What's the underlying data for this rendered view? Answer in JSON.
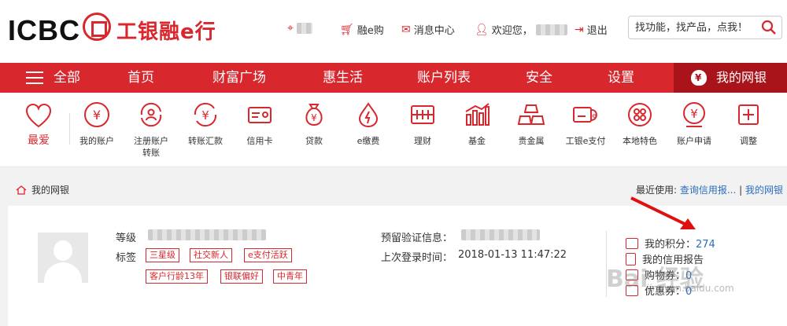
{
  "header": {
    "logo_text": "ICBC",
    "logo_cn": "工银融e行",
    "links": {
      "location": "",
      "rong_e_gou": "融e购",
      "messages": "消息中心",
      "welcome": "欢迎您，",
      "logout": "退出"
    },
    "search": {
      "placeholder": "找功能，找产品，点我！"
    }
  },
  "nav": {
    "items": [
      "全部",
      "首页",
      "财富广场",
      "惠生活",
      "账户列表",
      "安全",
      "设置"
    ],
    "mybank": "我的网银"
  },
  "quick": {
    "favorite": "最爱",
    "items": [
      {
        "label": "我的账户",
        "icon": "yen-circle-icon"
      },
      {
        "label": "注册账户\n转账",
        "icon": "registered-transfer-icon"
      },
      {
        "label": "转账汇款",
        "icon": "transfer-icon"
      },
      {
        "label": "信用卡",
        "icon": "credit-card-icon"
      },
      {
        "label": "贷款",
        "icon": "loan-bag-icon"
      },
      {
        "label": "e缴费",
        "icon": "payment-drop-icon"
      },
      {
        "label": "理财",
        "icon": "finance-icon"
      },
      {
        "label": "基金",
        "icon": "fund-chart-icon"
      },
      {
        "label": "贵金属",
        "icon": "gold-bars-icon"
      },
      {
        "label": "工银e支付",
        "icon": "epay-icon"
      },
      {
        "label": "本地特色",
        "icon": "local-feature-icon"
      },
      {
        "label": "账户申请",
        "icon": "account-apply-icon"
      },
      {
        "label": "调整",
        "icon": "adjust-icon"
      }
    ]
  },
  "breadcrumb": {
    "label": "我的网银"
  },
  "recent": {
    "label": "最近使用:",
    "links": [
      "查询信用报...",
      "我的网银"
    ],
    "separator": "|"
  },
  "account": {
    "level_label": "等级",
    "tag_label": "标签",
    "tags": [
      "三星级",
      "社交新人",
      "e支付活跃",
      "客户行龄13年",
      "银联偏好",
      "中青年"
    ],
    "verify_label": "预留验证信息：",
    "last_login_label": "上次登录时间：",
    "last_login_value": "2018-01-13 11:47:22",
    "points_label": "我的积分：",
    "points_value": "274",
    "credit_report": "我的信用报告",
    "coupon_label_1": "购物券：",
    "coupon_value_1": "0",
    "coupon_label_2": "优惠券：",
    "coupon_value_2": "0"
  },
  "watermark": {
    "main": "Bai 经验",
    "sub": "jingyan.baidu.com"
  },
  "colors": {
    "brand_red": "#d9272e",
    "nav_dark": "#a8141a",
    "link_blue": "#2a6ebd"
  }
}
